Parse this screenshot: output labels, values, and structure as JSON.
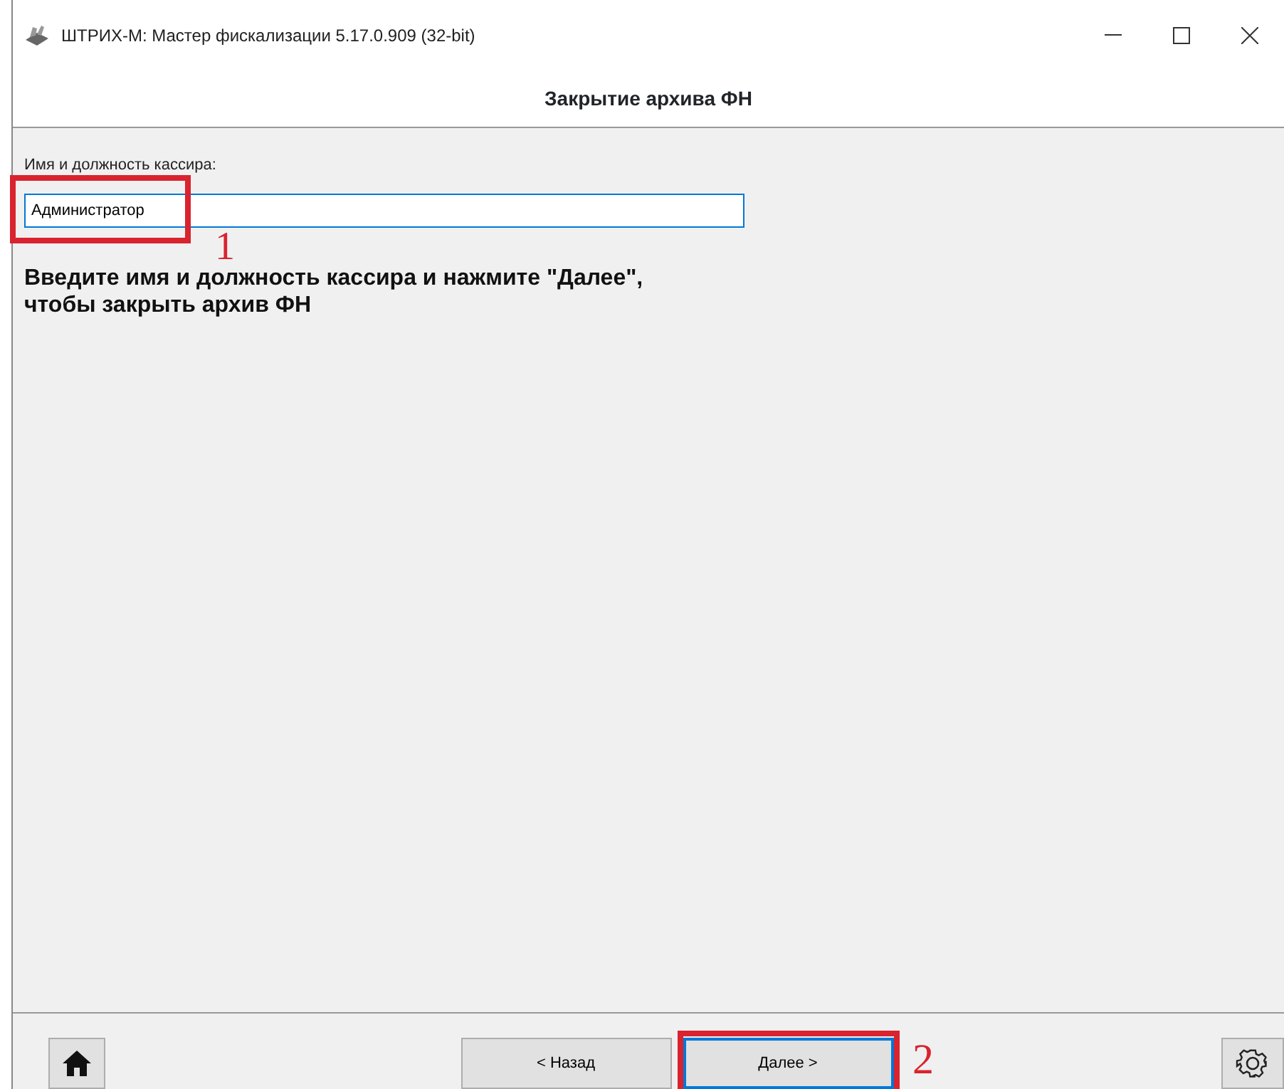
{
  "window": {
    "title": "ШТРИХ-М: Мастер фискализации 5.17.0.909 (32-bit)"
  },
  "header": {
    "title": "Закрытие архива ФН"
  },
  "form": {
    "label": "Имя и должность кассира:",
    "value": "Администратор",
    "focused": true
  },
  "instruction": [
    "Введите имя и должность кассира и нажмите \"Далее\",",
    "чтобы закрыть архив ФН"
  ],
  "buttons": [
    {
      "label": "< Назад",
      "focused": false
    },
    {
      "label": "Далее >",
      "focused": true
    }
  ],
  "annotations": [
    {
      "label": "1"
    },
    {
      "label": "2"
    }
  ]
}
